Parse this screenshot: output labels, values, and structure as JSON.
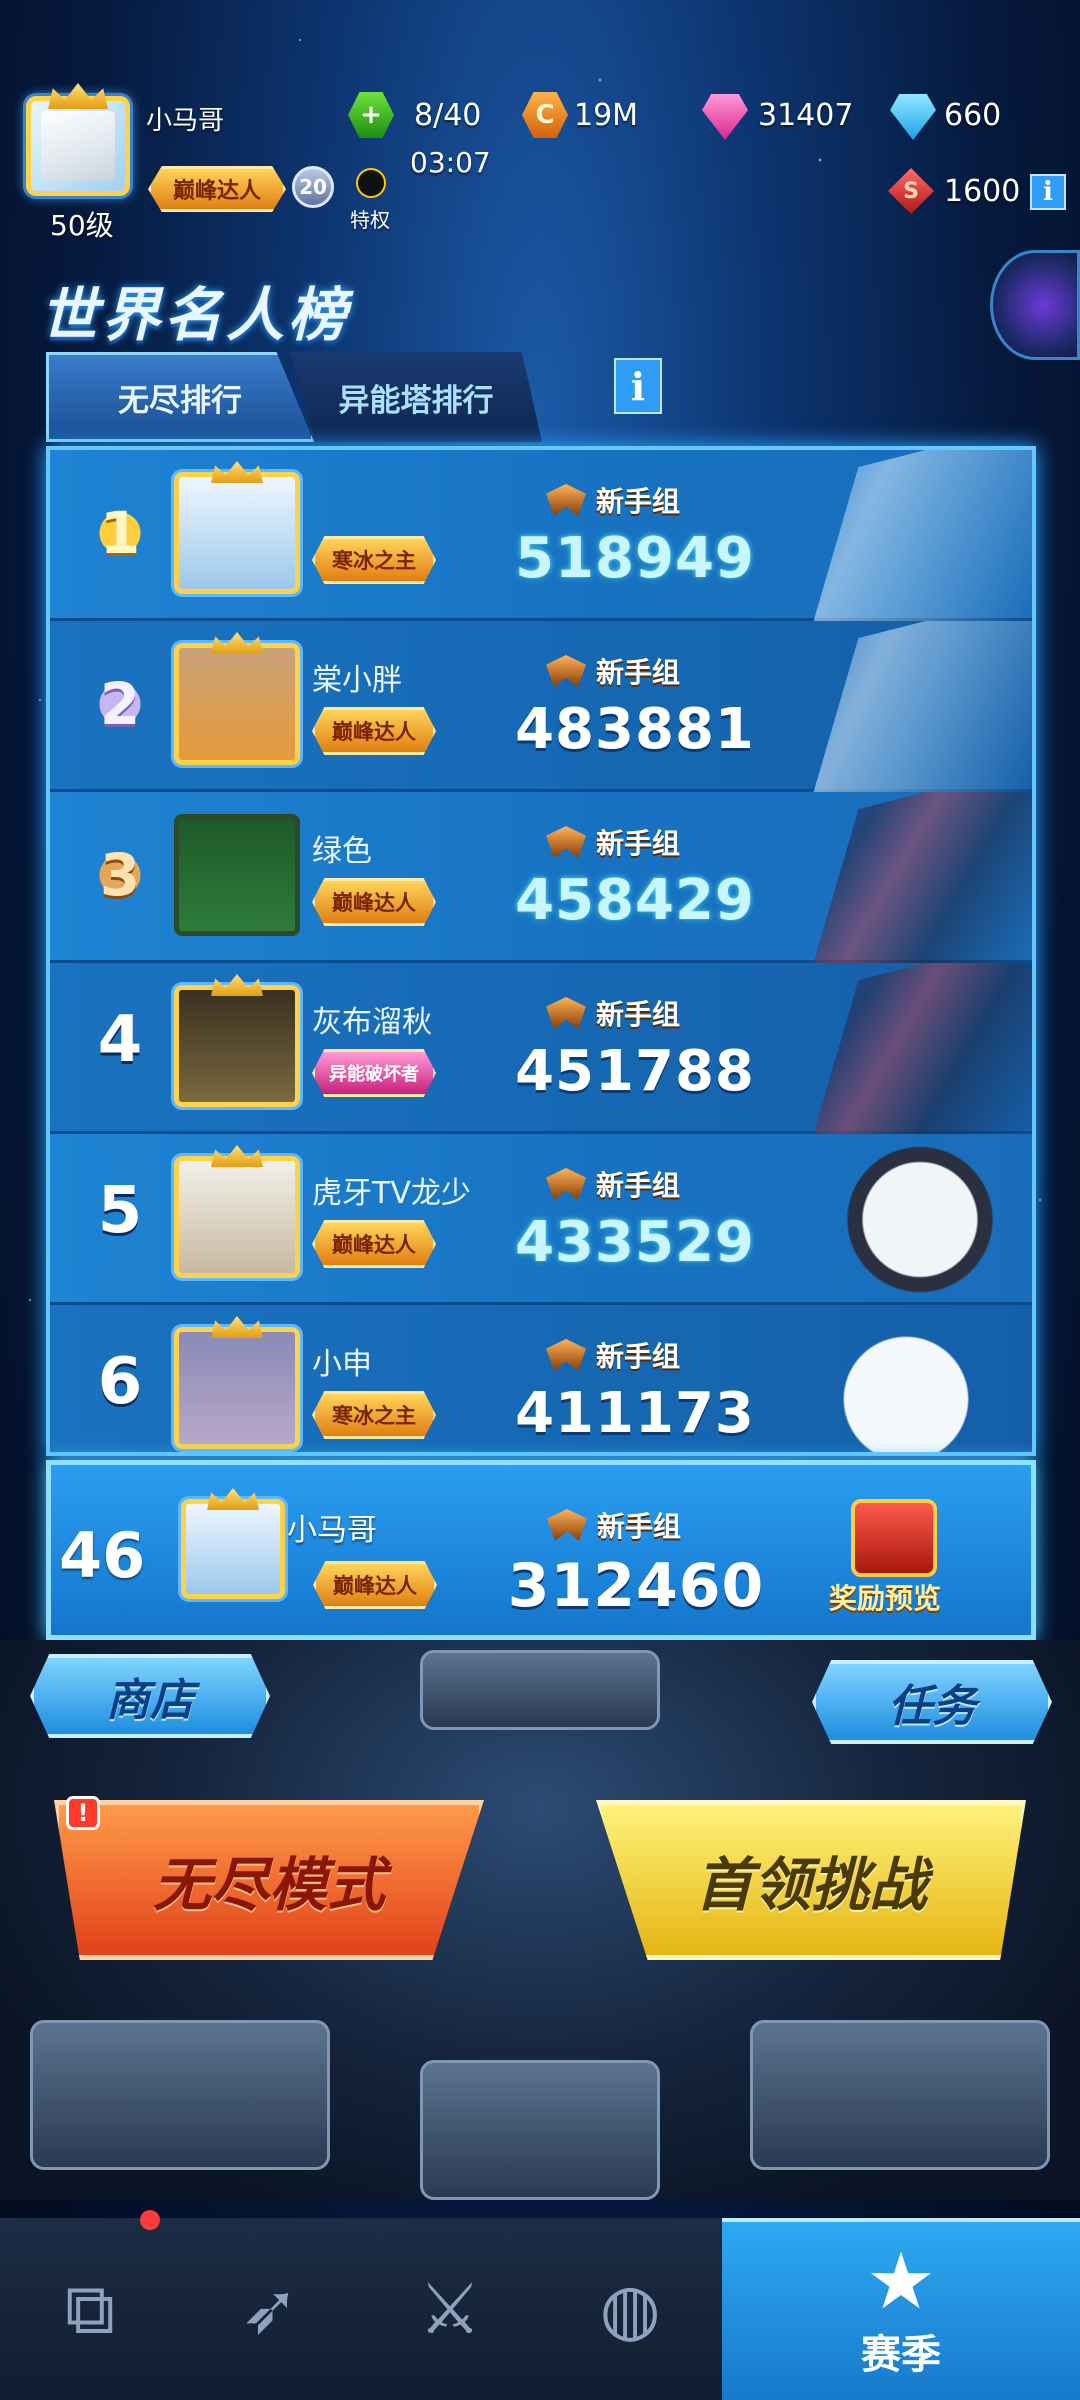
{
  "player": {
    "name": "小马哥",
    "level": "50级",
    "title_badge": "巅峰达人",
    "vip_level": "20",
    "privilege_label": "特权"
  },
  "resources": {
    "energy": "8/40",
    "energy_timer": "03:07",
    "coins": "19M",
    "pink_gems": "31407",
    "blue_gems": "660",
    "red_currency": "1600"
  },
  "page_title": "世界名人榜",
  "tabs": [
    "无尽排行",
    "异能塔排行"
  ],
  "info_label": "i",
  "leaderboard": [
    {
      "rank": "1",
      "name": "",
      "badge": "寒冰之主",
      "group": "新手组",
      "score": "518949",
      "medal": "gold"
    },
    {
      "rank": "2",
      "name": "棠小胖",
      "badge": "巅峰达人",
      "group": "新手组",
      "score": "483881",
      "medal": "silver"
    },
    {
      "rank": "3",
      "name": "绿色",
      "badge": "巅峰达人",
      "group": "新手组",
      "score": "458429",
      "medal": "bronze"
    },
    {
      "rank": "4",
      "name": "灰布溜秋",
      "badge": "异能破坏者",
      "group": "新手组",
      "score": "451788",
      "medal": "none"
    },
    {
      "rank": "5",
      "name": "虎牙TV龙少",
      "badge": "巅峰达人",
      "group": "新手组",
      "score": "433529",
      "medal": "none"
    },
    {
      "rank": "6",
      "name": "小申",
      "badge": "寒冰之主",
      "group": "新手组",
      "score": "411173",
      "medal": "none"
    }
  ],
  "my_rank": {
    "rank": "46",
    "name": "小马哥",
    "badge": "巅峰达人",
    "group": "新手组",
    "score": "312460",
    "reward_label": "奖励预览"
  },
  "buttons": {
    "shop": "商店",
    "missions": "任务",
    "endless_mode": "无尽模式",
    "boss_challenge": "首领挑战",
    "alert": "!"
  },
  "nav": {
    "season_label": "赛季",
    "active_index": 4
  },
  "colors": {
    "accent": "#2ea9f2",
    "score_cyan": "#c8f6ff",
    "gold": "#ffd24a",
    "endless": "#e1421a",
    "boss": "#e5b614"
  }
}
